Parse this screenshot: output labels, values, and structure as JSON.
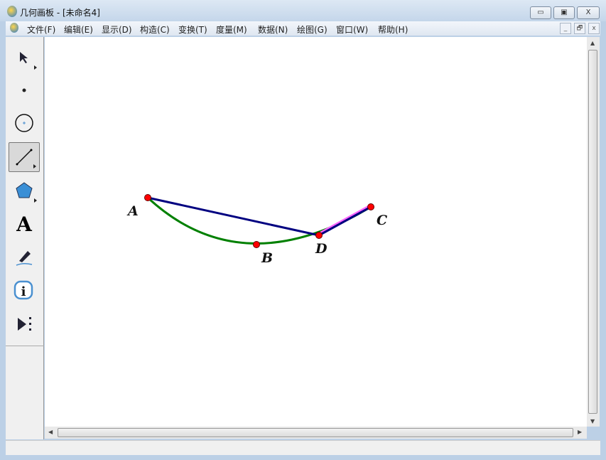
{
  "window": {
    "title": "几何画板 - [未命名4]",
    "minimize": "▭",
    "restore": "▣",
    "close": "X"
  },
  "menu": [
    "文件(F)",
    "编辑(E)",
    "显示(D)",
    "构造(C)",
    "变换(T)",
    "度量(M)",
    "数据(N)",
    "绘图(G)",
    "窗口(W)",
    "帮助(H)"
  ],
  "mdi": {
    "minimize": "_",
    "restore": "🗗",
    "close": "x"
  },
  "tools": {
    "text_tool": "A"
  },
  "points": {
    "A": "A",
    "B": "B",
    "C": "C",
    "D": "D"
  },
  "colors": {
    "segment": "#000080",
    "arc": "#008000",
    "point": "#ff0000",
    "highlight": "#ff66ff"
  }
}
